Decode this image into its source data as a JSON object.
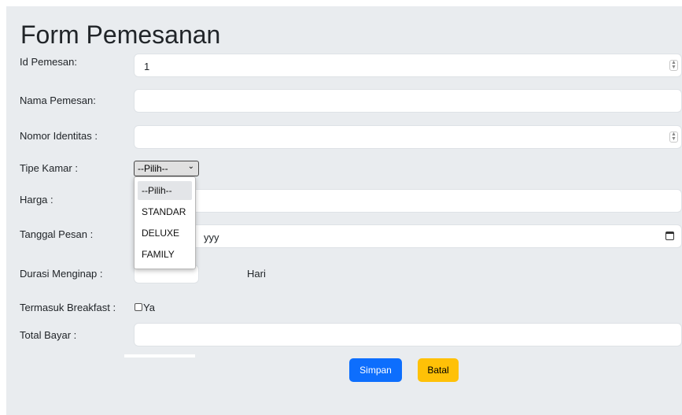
{
  "form": {
    "title": "Form Pemesanan",
    "id_label": "Id Pemesan:",
    "id_value": "1",
    "name_label": "Nama Pemesan:",
    "identity_label": "Nomor Identitas :",
    "room_type_label": "Tipe Kamar :",
    "room_type_selected": "--Pilih--",
    "room_type_options": [
      "--Pilih--",
      "STANDAR",
      "DELUXE",
      "FAMILY"
    ],
    "price_label": "Harga :",
    "date_label": "Tanggal Pesan :",
    "date_placeholder_visible": "yyy",
    "duration_label": "Durasi Menginap :",
    "duration_unit": "Hari",
    "breakfast_label": "Termasuk Breakfast :",
    "breakfast_option": "Ya",
    "total_label": "Total Bayar :",
    "save_button": "Simpan",
    "cancel_button": "Batal"
  },
  "colors": {
    "background": "#e9ecef",
    "primary": "#0d6efd",
    "warning": "#ffc107"
  },
  "icons": {
    "spinner": "number-spinner-icon",
    "calendar": "calendar-icon",
    "chevron": "chevron-down-icon"
  }
}
